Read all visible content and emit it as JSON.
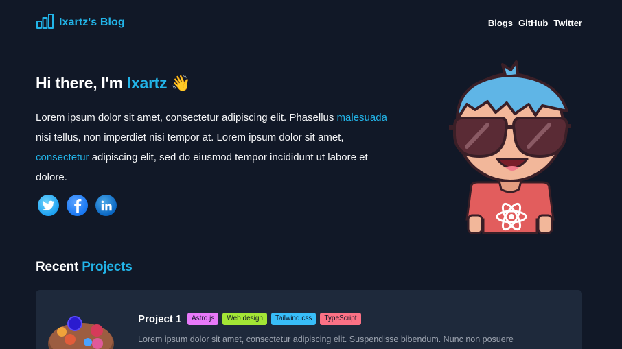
{
  "header": {
    "brand": "Ixartz's Blog",
    "nav": [
      {
        "label": "Blogs"
      },
      {
        "label": "GitHub"
      },
      {
        "label": "Twitter"
      }
    ]
  },
  "hero": {
    "greeting": "Hi there, I'm",
    "name": "Ixartz",
    "wave": "👋",
    "intro": {
      "p1": "Lorem ipsum dolor sit amet, consectetur adipiscing elit. Phasellus ",
      "link1": "malesuada",
      "p2": " nisi tellus, non imperdiet nisi tempor at. Lorem ipsum dolor sit amet, ",
      "link2": "consectetur",
      "p3": " adipiscing elit, sed do eiusmod tempor incididunt ut labore et dolore."
    },
    "socials": [
      "twitter-icon",
      "facebook-icon",
      "linkedin-icon"
    ]
  },
  "projects": {
    "title_prefix": "Recent",
    "title_accent": "Projects",
    "items": [
      {
        "title": "Project 1",
        "tags": [
          {
            "label": "Astro.js",
            "color": "#e879f9"
          },
          {
            "label": "Web design",
            "color": "#a3e635"
          },
          {
            "label": "Tailwind.css",
            "color": "#38bdf8"
          },
          {
            "label": "TypeScript",
            "color": "#fb7185"
          }
        ],
        "description": "Lorem ipsum dolor sit amet, consectetur adipiscing elit. Suspendisse bibendum. Nunc non posuere"
      }
    ]
  },
  "colors": {
    "background": "#111827",
    "accent": "#22b4e8",
    "card": "#1e293b"
  }
}
